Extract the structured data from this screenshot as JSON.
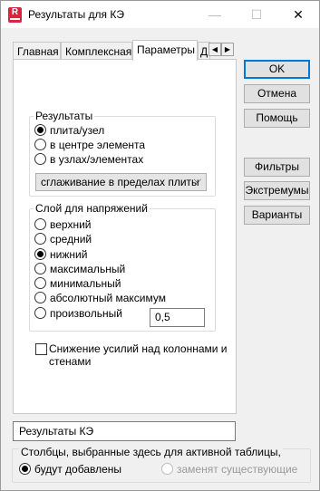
{
  "window": {
    "title": "Результаты для КЭ",
    "minimize": "—",
    "maximize": "☐",
    "close": "✕"
  },
  "tabs": [
    {
      "label": "Главная"
    },
    {
      "label": "Комплексная"
    },
    {
      "label": "Параметры",
      "active": true
    },
    {
      "label": "Д"
    }
  ],
  "tab_scroll": {
    "left": "◀",
    "right": "▶"
  },
  "buttons": {
    "ok": "OK",
    "cancel": "Отмена",
    "help": "Помощь",
    "filters": "Фильтры",
    "extrema": "Экстремумы",
    "variants": "Варианты"
  },
  "results_group": {
    "label": "Результаты",
    "options": [
      "плита/узел",
      "в центре элемента",
      "в узлах/элементах"
    ],
    "selected_index": 0,
    "smoothing": {
      "value": "сглаживание в пределах плиты",
      "chevron": "⌵"
    }
  },
  "stress_layer_group": {
    "label": "Слой для напряжений",
    "options": [
      "верхний",
      "средний",
      "нижний",
      "максимальный",
      "минимальный",
      "абсолютный максимум",
      "произвольный"
    ],
    "selected_index": 2,
    "custom_value": "0,5"
  },
  "reduction_checkbox": {
    "line1": "Снижение усилий над колоннами и",
    "line2": "стенами",
    "checked": false
  },
  "table_name": "Результаты КЭ",
  "columns_group": {
    "label": "Столбцы, выбранные здесь для активной таблицы,",
    "options": [
      "будут добавлены",
      "заменят существующие"
    ],
    "selected_index": 0
  },
  "colors": {
    "accent": "#0078d7",
    "app_icon": "#d7263d"
  }
}
